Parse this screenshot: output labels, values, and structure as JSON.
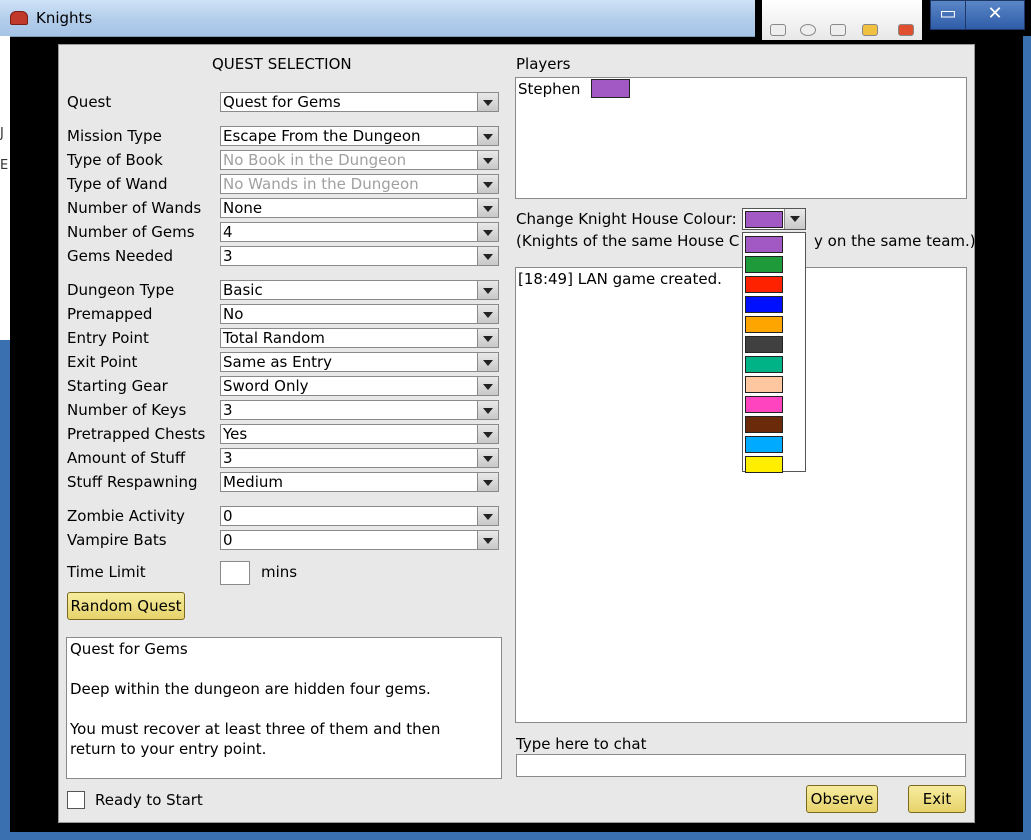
{
  "window": {
    "title": "Knights"
  },
  "left_edge_fragments": [
    "J",
    "E"
  ],
  "quest_panel": {
    "heading": "QUEST SELECTION",
    "fields": [
      {
        "label": "Quest",
        "value": "Quest for Gems",
        "disabled": false
      },
      {
        "label": "Mission Type",
        "value": "Escape From the Dungeon",
        "disabled": false
      },
      {
        "label": "Type of Book",
        "value": "No Book in the Dungeon",
        "disabled": true
      },
      {
        "label": "Type of Wand",
        "value": "No Wands in the Dungeon",
        "disabled": true
      },
      {
        "label": "Number of Wands",
        "value": "None",
        "disabled": false
      },
      {
        "label": "Number of Gems",
        "value": "4",
        "disabled": false
      },
      {
        "label": "Gems Needed",
        "value": "3",
        "disabled": false
      },
      {
        "label": "Dungeon Type",
        "value": "Basic",
        "disabled": false
      },
      {
        "label": "Premapped",
        "value": "No",
        "disabled": false
      },
      {
        "label": "Entry Point",
        "value": "Total Random",
        "disabled": false
      },
      {
        "label": "Exit Point",
        "value": "Same as Entry",
        "disabled": false
      },
      {
        "label": "Starting Gear",
        "value": "Sword Only",
        "disabled": false
      },
      {
        "label": "Number of Keys",
        "value": "3",
        "disabled": false
      },
      {
        "label": "Pretrapped Chests",
        "value": "Yes",
        "disabled": false
      },
      {
        "label": "Amount of Stuff",
        "value": "3",
        "disabled": false
      },
      {
        "label": "Stuff Respawning",
        "value": "Medium",
        "disabled": false
      },
      {
        "label": "Zombie Activity",
        "value": "0",
        "disabled": false
      },
      {
        "label": "Vampire Bats",
        "value": "0",
        "disabled": false
      }
    ],
    "time_limit_label": "Time Limit",
    "time_limit_value": "",
    "time_limit_unit": "mins",
    "random_quest_button": "Random Quest",
    "description": [
      "Quest for Gems",
      "",
      "Deep within the dungeon are hidden four gems.",
      "",
      "You must recover at least three of them and then",
      "return to your entry point."
    ],
    "ready_label": "Ready to Start"
  },
  "players_panel": {
    "heading": "Players",
    "players": [
      {
        "name": "Stephen",
        "color": "#a259c4"
      }
    ],
    "house_colour_label": "Change Knight House Colour:",
    "house_colour_selected": "#a259c4",
    "team_note_left": "(Knights of the same House C",
    "team_note_right": "y on the same team.)",
    "colour_options": [
      "#a259c4",
      "#1f9a3a",
      "#ff2200",
      "#0010ff",
      "#ffa500",
      "#404040",
      "#00b386",
      "#ffc7a0",
      "#ff44c0",
      "#6b2a0a",
      "#00aaff",
      "#ffee00"
    ]
  },
  "chat": {
    "log": [
      "[18:49] LAN game created."
    ],
    "prompt_label": "Type here to chat",
    "input_value": ""
  },
  "buttons": {
    "observe": "Observe",
    "exit": "Exit"
  }
}
